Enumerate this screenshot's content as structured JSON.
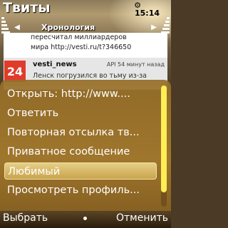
{
  "app": {
    "title": "Твиты",
    "clock": "15:14"
  },
  "tabs": {
    "current": "Хронология"
  },
  "tweets": [
    {
      "text_line1": "пересчитал миллиардеров",
      "text_line2": "мира http://vesti.ru/t?346650"
    },
    {
      "avatar_text": "24",
      "user": "vesti_news",
      "source": "API",
      "time": "54 минут назад",
      "text": "Ленск погрузился во тьму из-за"
    }
  ],
  "menu": {
    "items": [
      {
        "label": "Открыть: http://www...."
      },
      {
        "label": "Ответить"
      },
      {
        "label": "Повторная отсылка тв..."
      },
      {
        "label": "Приватное сообщение"
      },
      {
        "label": "Любимый",
        "selected": true
      },
      {
        "label": "Просмотреть профиль..."
      }
    ]
  },
  "softkeys": {
    "left": "Выбрать",
    "right": "Отменить"
  },
  "colors": {
    "menu_bg": "#a57a2d",
    "selected_bg": "#d9bc6a",
    "avatar": "#e03c2b",
    "scroll_thumb": "#ffee55"
  },
  "icons": {
    "signal": "signal-strength-icon",
    "battery": "battery-level-icon",
    "settings": "settings-icon",
    "tab_left": "chevron-left-icon",
    "tab_right": "chevron-right-icon"
  }
}
